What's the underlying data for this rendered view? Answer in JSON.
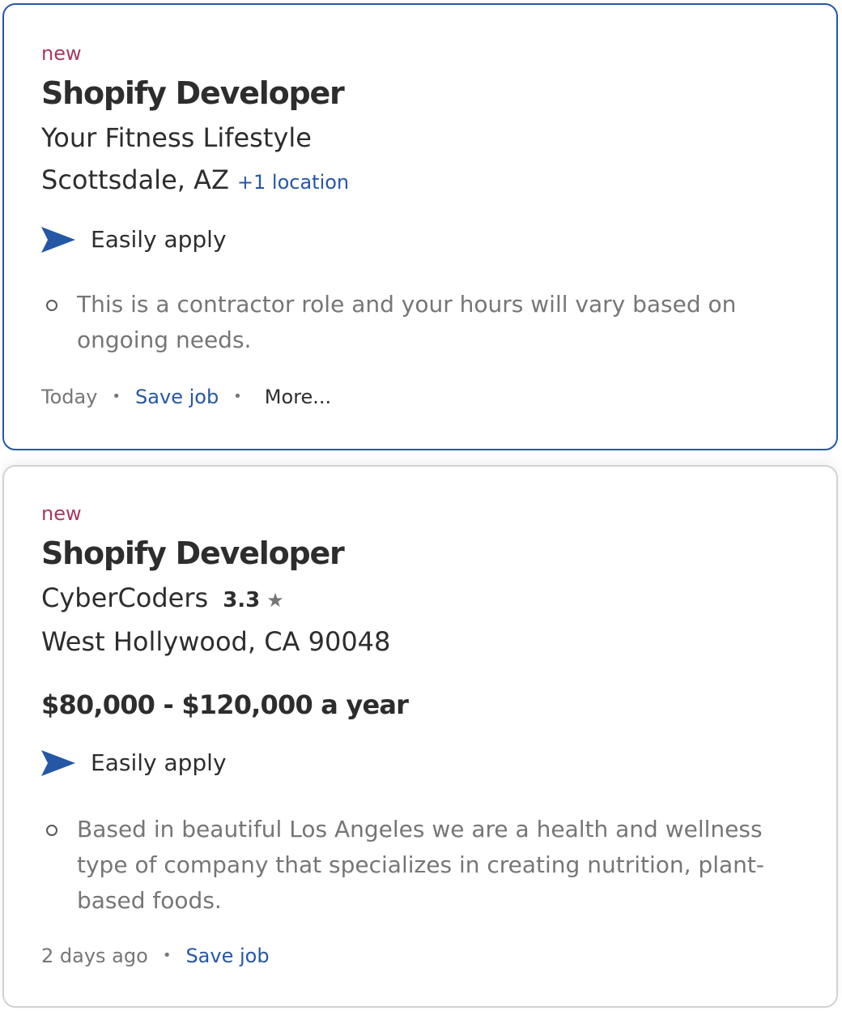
{
  "jobs": [
    {
      "badge": "new",
      "title": "Shopify Developer",
      "company": "Your Fitness Lifestyle",
      "location": "Scottsdale, AZ",
      "extra_locations": "+1 location",
      "apply_label": "Easily apply",
      "snippet": "This is a contractor role and your hours will vary based on ongoing needs.",
      "posted": "Today",
      "save_label": "Save job",
      "more_label": "More..."
    },
    {
      "badge": "new",
      "title": "Shopify Developer",
      "company": "CyberCoders",
      "rating": "3.3",
      "rating_icon": "star-icon",
      "location": "West Hollywood, CA 90048",
      "salary": "$80,000 - $120,000 a year",
      "apply_label": "Easily apply",
      "snippet": "Based in beautiful Los Angeles we are a health and wellness type of company that specializes in creating nutrition, plant-based foods.",
      "posted": "2 days ago",
      "save_label": "Save job"
    }
  ],
  "colors": {
    "accent": "#2557a7",
    "badge": "#a9385f",
    "text": "#2d2d2d",
    "muted": "#767676",
    "selected_border": "#2557a7",
    "card_border": "#d4d2d0"
  }
}
